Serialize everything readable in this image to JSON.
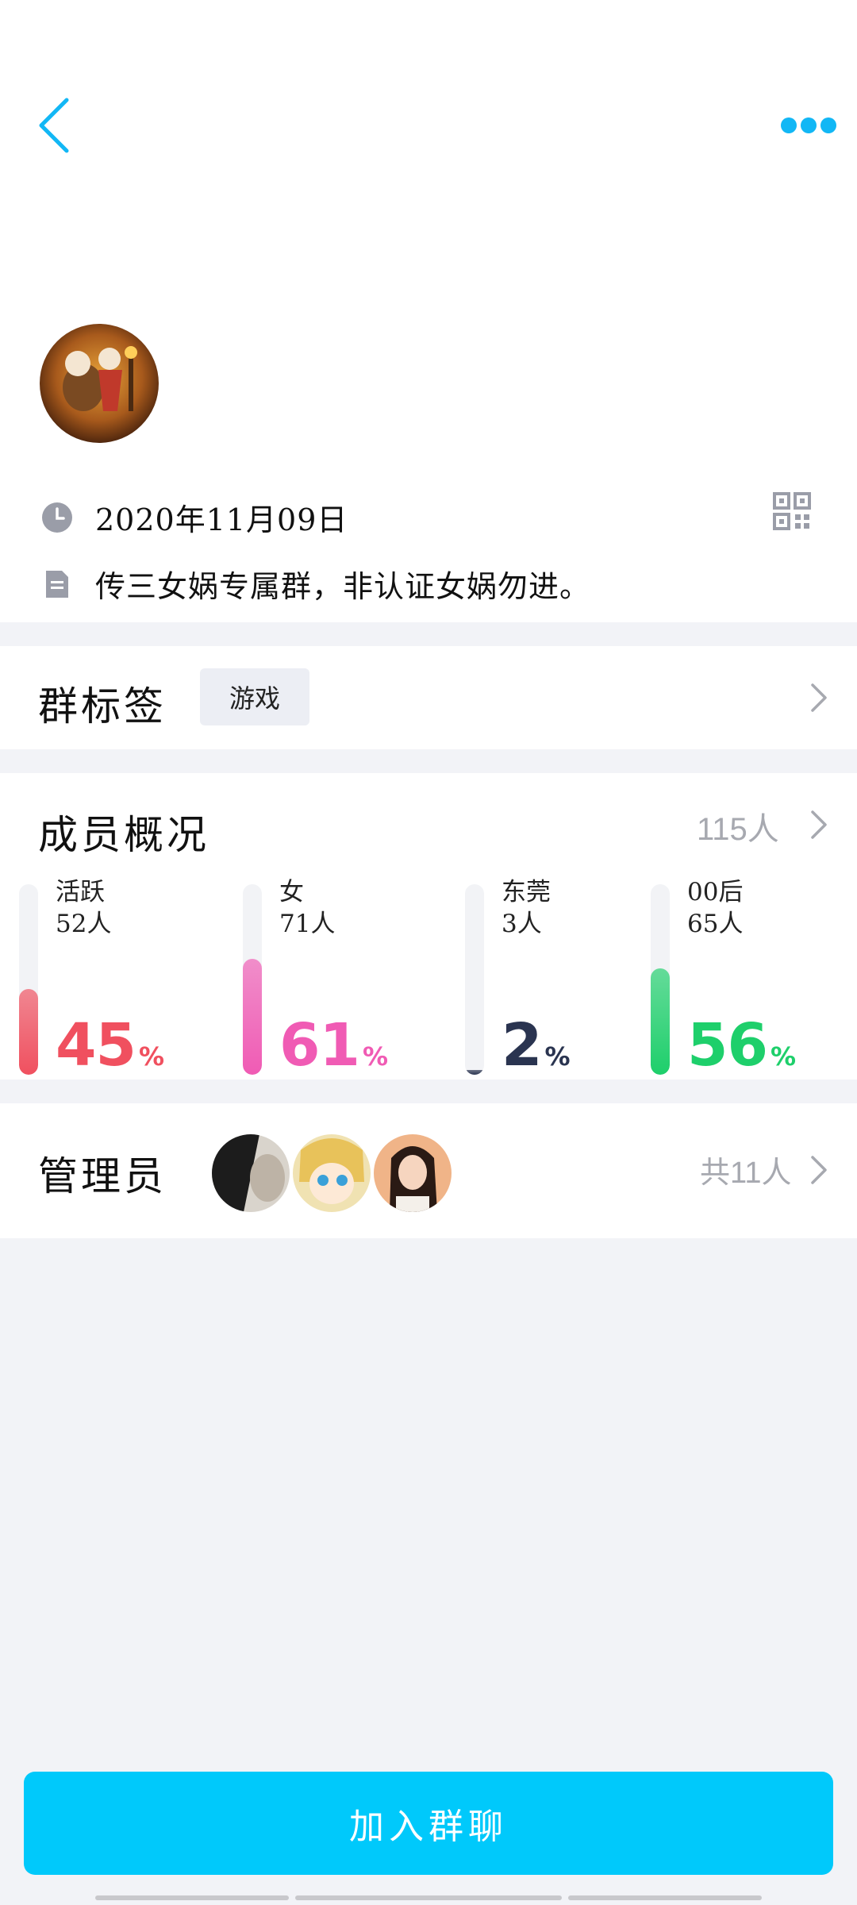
{
  "group": {
    "created_date": "2020年11月09日",
    "description": "传三女娲专属群，非认证女娲勿进。"
  },
  "tags": {
    "title": "群标签",
    "items": [
      "游戏"
    ]
  },
  "members": {
    "title": "成员概况",
    "count": "115人",
    "stats": [
      {
        "label": "活跃",
        "sub": "52人",
        "percent": "45",
        "unit": "%",
        "color": "#f0505f"
      },
      {
        "label": "女",
        "sub": "71人",
        "percent": "61",
        "unit": "%",
        "color": "#f05bb4"
      },
      {
        "label": "东莞",
        "sub": "3人",
        "percent": "2",
        "unit": "%",
        "color": "#2a3450"
      },
      {
        "label": "00后",
        "sub": "65人",
        "percent": "56",
        "unit": "%",
        "color": "#1ecf6b"
      }
    ]
  },
  "admins": {
    "title": "管理员",
    "count": "共11人"
  },
  "actions": {
    "join_label": "加入群聊"
  },
  "colors": {
    "accent": "#12b7f5",
    "join_button": "#00c9fb"
  }
}
